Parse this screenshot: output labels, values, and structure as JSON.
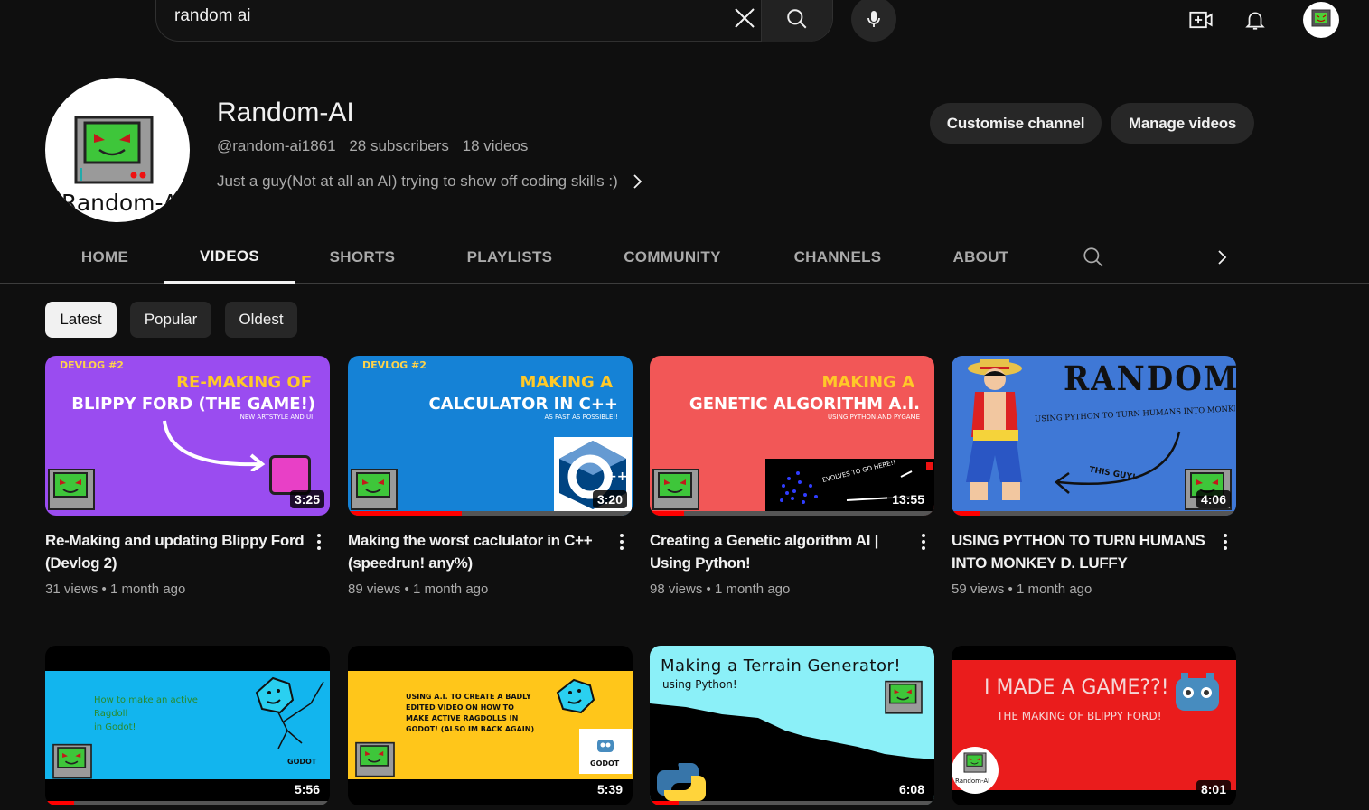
{
  "search": {
    "query": "random ai"
  },
  "top_avatar": {
    "label": "Random-AI"
  },
  "channel": {
    "name": "Random-AI",
    "avatar_text": "Random-AI",
    "handle": "@random-ai1861",
    "subscribers": "28 subscribers",
    "videos": "18 videos",
    "description": "Just a guy(Not at all an AI) trying to show off coding skills :)",
    "customise_label": "Customise channel",
    "manage_label": "Manage videos"
  },
  "tabs": [
    "HOME",
    "VIDEOS",
    "SHORTS",
    "PLAYLISTS",
    "COMMUNITY",
    "CHANNELS",
    "ABOUT"
  ],
  "active_tab": "VIDEOS",
  "chips": [
    "Latest",
    "Popular",
    "Oldest"
  ],
  "active_chip": "Latest",
  "videos": [
    {
      "title": "Re-Making and updating Blippy Ford (Devlog 2)",
      "views": "31 views",
      "age": "1 month ago",
      "duration": "3:25",
      "thumb": {
        "tag": "DEVLOG #2",
        "line1": "RE-MAKING OF",
        "line2": "BLIPPY FORD (THE GAME!)",
        "sub": "NEW ARTSTYLE AND UI!"
      }
    },
    {
      "title": "Making the worst caclulator in C++ (speedrun! any%)",
      "views": "89 views",
      "age": "1 month ago",
      "duration": "3:20",
      "thumb": {
        "tag": "DEVLOG #2",
        "line1": "MAKING A",
        "line2": "CALCULATOR IN C++",
        "sub": "AS FAST AS POSSIBLE!!"
      }
    },
    {
      "title": "Creating a Genetic algorithm AI | Using Python!",
      "views": "98 views",
      "age": "1 month ago",
      "duration": "13:55",
      "thumb": {
        "line1": "MAKING A",
        "line2": "GENETIC ALGORITHM A.I.",
        "sub": "USING PYTHON AND PYGAME",
        "note": "EVOLVES TO GO HERE!!"
      }
    },
    {
      "title": "USING PYTHON TO TURN HUMANS INTO MONKEY D. LUFFY",
      "views": "59 views",
      "age": "1 month ago",
      "duration": "4:06",
      "thumb": {
        "line1": "RANDOM AI",
        "sub": "USING PYTHON TO TURN HUMANS INTO MONKEY D. LUFFY",
        "note": "THIS GUY!"
      }
    },
    {
      "duration": "5:56",
      "thumb": {
        "line1": "How to make an active",
        "line2": "Ragdoll",
        "line3": "in Godot!",
        "logo": "GODOT"
      }
    },
    {
      "duration": "5:39",
      "thumb": {
        "line1": "USING A.I. TO CREATE A BADLY",
        "line2": "EDITED VIDEO ON HOW TO",
        "line3": "MAKE ACTIVE RAGDOLLS IN",
        "line4": "GODOT! (ALSO IM BACK AGAIN)",
        "logo": "GODOT"
      }
    },
    {
      "duration": "6:08",
      "thumb": {
        "line1": "Making a Terrain Generator!",
        "line2": "using Python!"
      }
    },
    {
      "duration": "8:01",
      "thumb": {
        "line1": "I MADE A GAME??!",
        "line2": "THE MAKING OF BLIPPY FORD!",
        "badge": "Random-AI"
      }
    }
  ],
  "colors": {
    "bg": "#0f0f0f",
    "chip": "#272727",
    "progress": "#ff0000",
    "text_secondary": "#aaaaaa"
  }
}
